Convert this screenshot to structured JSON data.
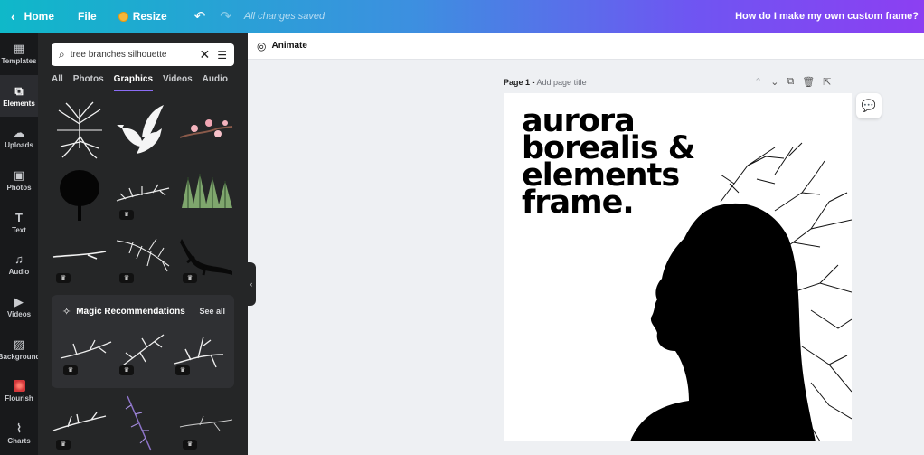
{
  "topbar": {
    "home_label": "Home",
    "file_label": "File",
    "resize_label": "Resize",
    "undo_icon": "undo-icon",
    "redo_icon": "redo-icon",
    "saved_status": "All changes saved",
    "custom_frame_link": "How do I make my own custom frame?"
  },
  "rail": {
    "items": [
      {
        "label": "Templates",
        "icon": "templates-icon"
      },
      {
        "label": "Elements",
        "icon": "elements-icon"
      },
      {
        "label": "Uploads",
        "icon": "uploads-icon"
      },
      {
        "label": "Photos",
        "icon": "photos-icon"
      },
      {
        "label": "Text",
        "icon": "text-icon"
      },
      {
        "label": "Audio",
        "icon": "audio-icon"
      },
      {
        "label": "Videos",
        "icon": "videos-icon"
      },
      {
        "label": "Background",
        "icon": "background-icon"
      },
      {
        "label": "Flourish",
        "icon": "flourish-icon"
      },
      {
        "label": "Charts",
        "icon": "charts-icon"
      }
    ]
  },
  "panel": {
    "search_value": "tree branches silhouette",
    "tabs": [
      "All",
      "Photos",
      "Graphics",
      "Videos",
      "Audio"
    ],
    "active_tab": "Graphics",
    "magic_title": "Magic Recommendations",
    "see_all": "See all"
  },
  "canvas": {
    "animate_label": "Animate",
    "page_label": "Page 1 -",
    "page_title_placeholder": "Add page title",
    "headline": [
      "aurora",
      "borealis &",
      "elements",
      "frame."
    ]
  },
  "colors": {
    "accent": "#8b6cf5",
    "panel_bg": "#252627",
    "rail_bg": "#18191b"
  }
}
